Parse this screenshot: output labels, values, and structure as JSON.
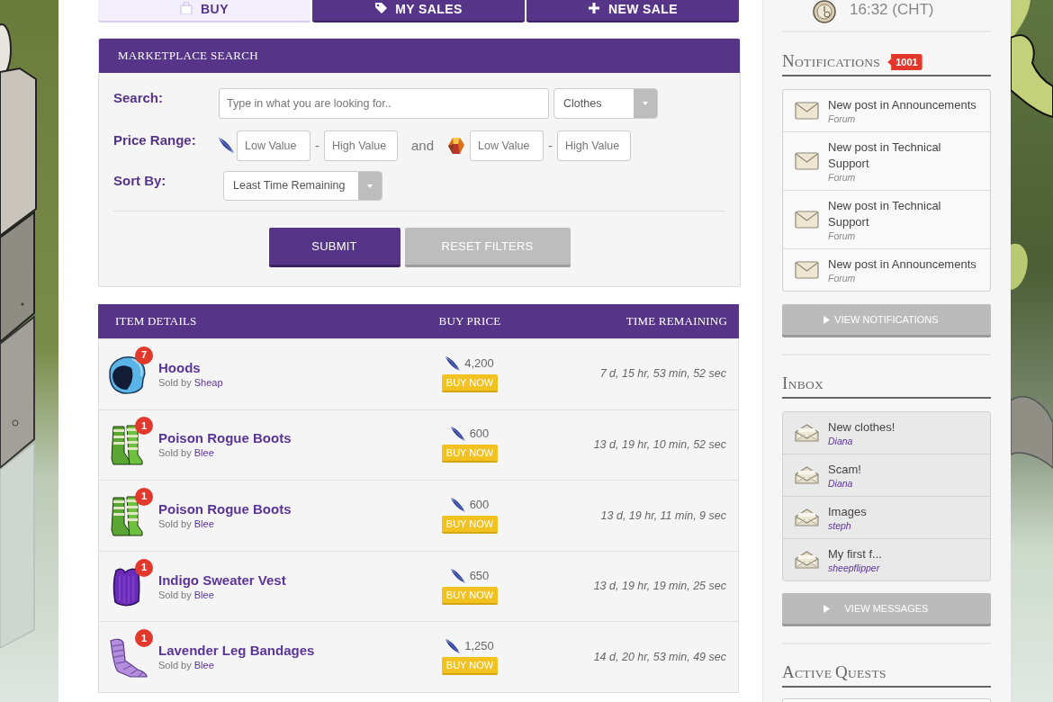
{
  "tabs": [
    {
      "label": "BUY",
      "selected": true
    },
    {
      "label": "MY SALES",
      "selected": false
    },
    {
      "label": "NEW SALE",
      "selected": false
    }
  ],
  "clock": {
    "time": "16:32 (CHT)"
  },
  "search_panel": {
    "title": "MARKETPLACE SEARCH",
    "search": {
      "label": "Search:",
      "placeholder": "Type in what you are looking for..",
      "category": "Clothes"
    },
    "price_range": {
      "label": "Price Range:",
      "joiner": "and",
      "ranges": [
        {
          "kind": "feather",
          "low": {
            "placeholder": "Low Value"
          },
          "separator": "-",
          "high": {
            "placeholder": "High Value"
          }
        },
        {
          "kind": "gem",
          "low": {
            "placeholder": "Low Value"
          },
          "separator": "-",
          "high": {
            "placeholder": "High Value"
          }
        }
      ]
    },
    "sort": {
      "label": "Sort By:",
      "value": "Least Time Remaining"
    },
    "buttons": [
      {
        "label": "SUBMIT",
        "kind": "primary"
      },
      {
        "label": "RESET FILTERS",
        "kind": "secondary"
      }
    ]
  },
  "listings": {
    "columns": [
      "ITEM DETAILS",
      "BUY PRICE",
      "TIME REMAINING"
    ],
    "rows": [
      {
        "kind": "hood",
        "count": "7",
        "name": "Hoods",
        "sold_by": "Sold by",
        "seller": "Sheap",
        "price": "4,200",
        "action": "BUY NOW",
        "time": "7 d, 15 hr, 53 min, 52 sec"
      },
      {
        "kind": "boots",
        "count": "1",
        "name": "Poison Rogue Boots",
        "sold_by": "Sold by",
        "seller": "Blee",
        "price": "600",
        "action": "BUY NOW",
        "time": "13 d, 19 hr, 10 min, 52 sec"
      },
      {
        "kind": "boots",
        "count": "1",
        "name": "Poison Rogue Boots",
        "sold_by": "Sold by",
        "seller": "Blee",
        "price": "600",
        "action": "BUY NOW",
        "time": "13 d, 19 hr, 11 min, 9 sec"
      },
      {
        "kind": "vest",
        "count": "1",
        "name": "Indigo Sweater Vest",
        "sold_by": "Sold by",
        "seller": "Blee",
        "price": "650",
        "action": "BUY NOW",
        "time": "13 d, 19 hr, 19 min, 25 sec"
      },
      {
        "kind": "bandages",
        "count": "1",
        "name": "Lavender Leg Bandages",
        "sold_by": "Sold by",
        "seller": "Blee",
        "price": "1,250",
        "action": "BUY NOW",
        "time": "14 d, 20 hr, 53 min, 49 sec"
      }
    ]
  },
  "notifications": {
    "title": "NOTIFICATIONS",
    "count": "1001",
    "items": [
      {
        "title": "New post in Announcements",
        "source": "Forum",
        "read": false
      },
      {
        "title": "New post in Technical Support",
        "source": "Forum",
        "read": false
      },
      {
        "title": "New post in Technical Support",
        "source": "Forum",
        "read": false
      },
      {
        "title": "New post in Announcements",
        "source": "Forum",
        "read": false
      }
    ],
    "button": "VIEW NOTIFICATIONS"
  },
  "inbox": {
    "title": "INBOX",
    "items": [
      {
        "subject": "New clothes!",
        "sender": "Diana",
        "read": true
      },
      {
        "subject": "Scam!",
        "sender": "Diana",
        "read": true
      },
      {
        "subject": "Images",
        "sender": "steph",
        "read": true
      },
      {
        "subject": "My first f...",
        "sender": "sheepflipper",
        "read": true
      }
    ],
    "button": "VIEW MESSAGES"
  },
  "active_quests": {
    "title": "ACTIVE QUESTS"
  }
}
